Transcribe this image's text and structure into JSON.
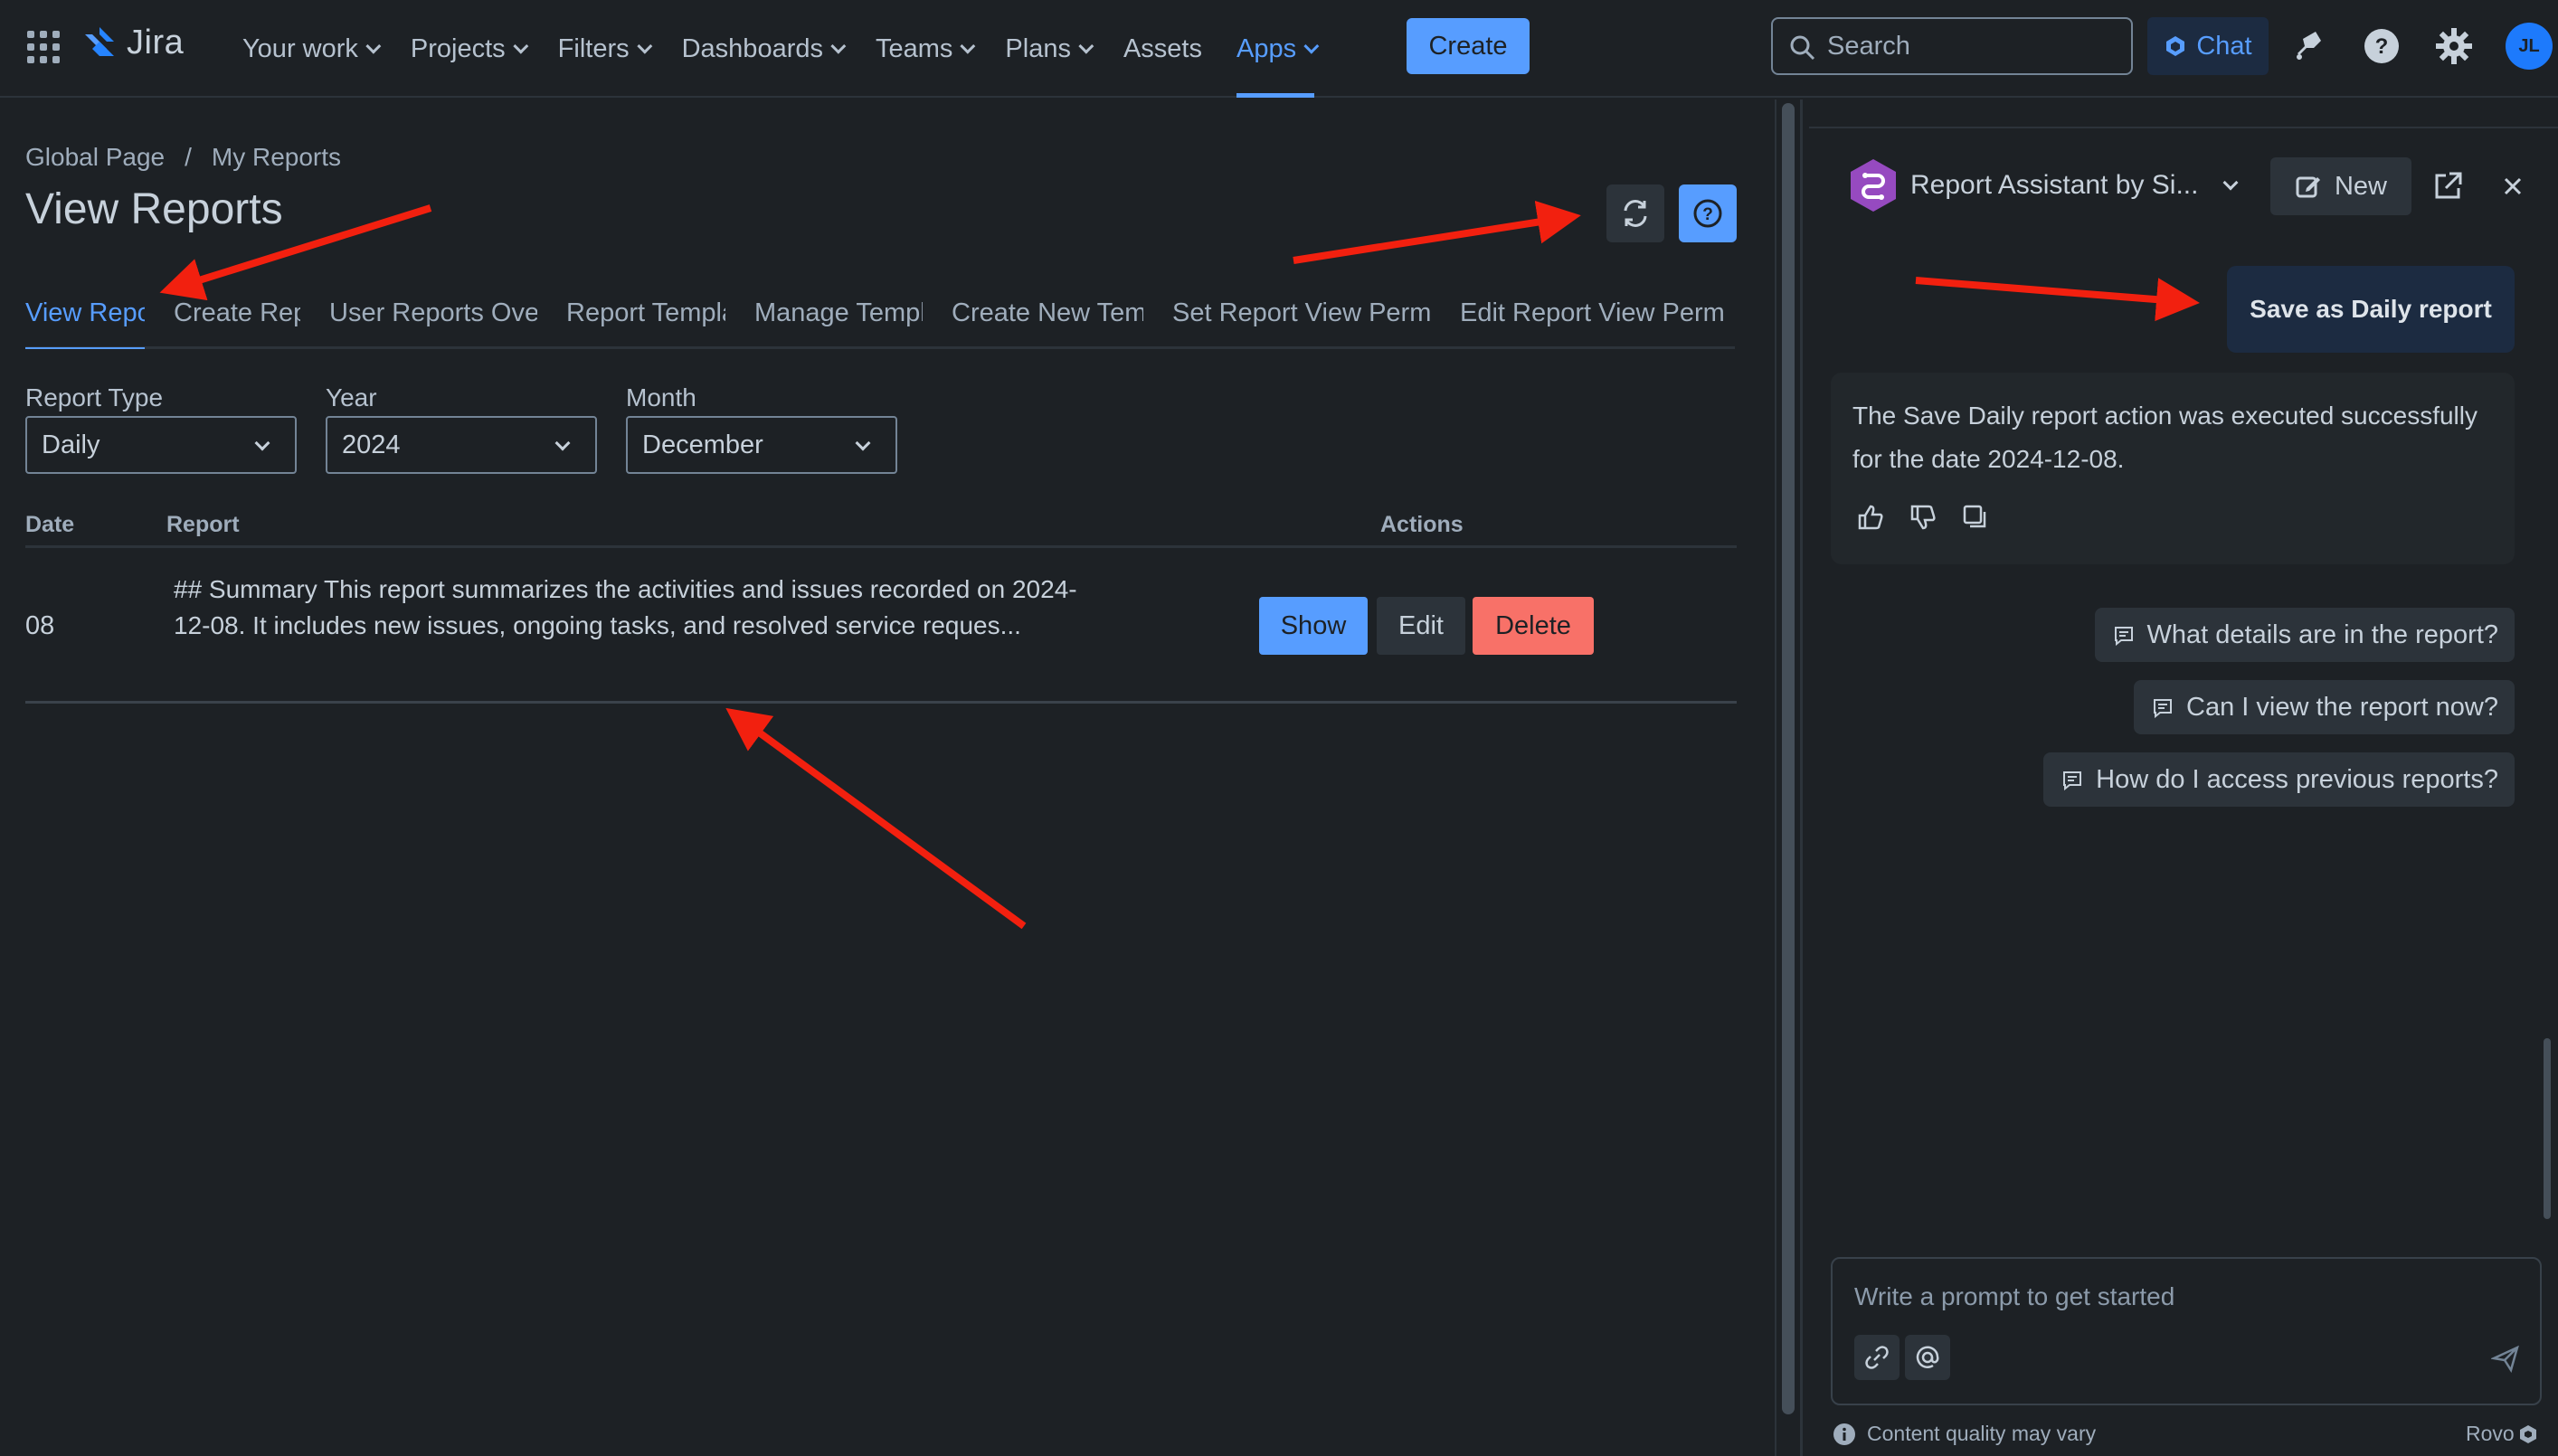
{
  "nav": {
    "logo_text": "Jira",
    "links": [
      {
        "label": "Your work",
        "dropdown": true
      },
      {
        "label": "Projects",
        "dropdown": true
      },
      {
        "label": "Filters",
        "dropdown": true
      },
      {
        "label": "Dashboards",
        "dropdown": true
      },
      {
        "label": "Teams",
        "dropdown": true
      },
      {
        "label": "Plans",
        "dropdown": true
      },
      {
        "label": "Assets",
        "dropdown": false
      },
      {
        "label": "Apps",
        "dropdown": true,
        "active": true
      }
    ],
    "create_label": "Create",
    "search_placeholder": "Search",
    "chat_label": "Chat",
    "avatar_initials": "JL",
    "accent_color": "#579dff"
  },
  "breadcrumb": [
    "Global Page",
    "My Reports"
  ],
  "page_title": "View Reports",
  "tabs": [
    {
      "label": "View Reports",
      "active": true
    },
    {
      "label": "Create Reports"
    },
    {
      "label": "User Reports Overview"
    },
    {
      "label": "Report Templates"
    },
    {
      "label": "Manage Templates"
    },
    {
      "label": "Create New Template"
    },
    {
      "label": "Set Report View Permissions"
    },
    {
      "label": "Edit Report View Permissions"
    }
  ],
  "filters": {
    "report_type": {
      "label": "Report Type",
      "value": "Daily"
    },
    "year": {
      "label": "Year",
      "value": "2024"
    },
    "month": {
      "label": "Month",
      "value": "December"
    }
  },
  "table": {
    "headers": {
      "date": "Date",
      "report": "Report",
      "actions": "Actions"
    },
    "rows": [
      {
        "date": "08",
        "report": "## Summary This report summarizes the activities and issues recorded on 2024-12-08. It includes new issues, ongoing tasks, and resolved service reques...",
        "show": "Show",
        "edit": "Edit",
        "delete": "Delete"
      }
    ]
  },
  "panel": {
    "agent_name": "Report Assistant by Si...",
    "new_label": "New",
    "user_message": "Save as Daily report",
    "bot_message": "The Save Daily report action was executed successfully for the date 2024-12-08.",
    "suggestions": [
      "What details are in the report?",
      "Can I view the report now?",
      "How do I access previous reports?"
    ],
    "prompt_placeholder": "Write a prompt to get started",
    "footer_note": "Content quality may vary",
    "brand": "Rovo"
  },
  "colors": {
    "background": "#1d2125",
    "primary_button": "#579dff",
    "danger_button": "#f87168",
    "annotation_arrow": "#f2200f"
  }
}
